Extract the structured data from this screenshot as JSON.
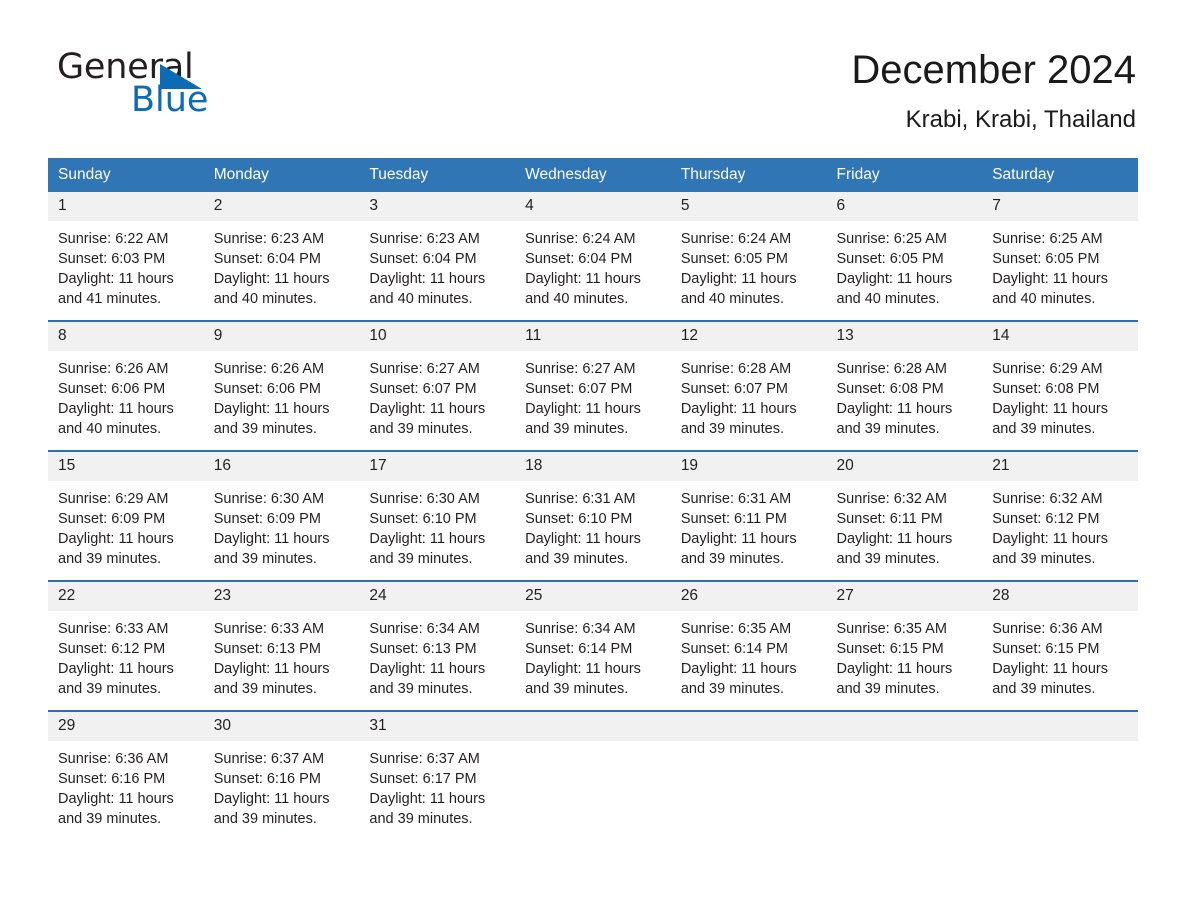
{
  "brand": {
    "name_part1": "General",
    "name_part2": "Blue",
    "accent_color": "#0b6cb5"
  },
  "header": {
    "month_title": "December 2024",
    "location": "Krabi, Krabi, Thailand"
  },
  "theme": {
    "header_blue": "#3075b4",
    "divider_blue": "#2f6fab",
    "daynum_band": "#f1f1f1"
  },
  "weekday_headers": [
    "Sunday",
    "Monday",
    "Tuesday",
    "Wednesday",
    "Thursday",
    "Friday",
    "Saturday"
  ],
  "weeks": [
    [
      {
        "day": "1",
        "sunrise": "Sunrise: 6:22 AM",
        "sunset": "Sunset: 6:03 PM",
        "daylight1": "Daylight: 11 hours",
        "daylight2": "and 41 minutes."
      },
      {
        "day": "2",
        "sunrise": "Sunrise: 6:23 AM",
        "sunset": "Sunset: 6:04 PM",
        "daylight1": "Daylight: 11 hours",
        "daylight2": "and 40 minutes."
      },
      {
        "day": "3",
        "sunrise": "Sunrise: 6:23 AM",
        "sunset": "Sunset: 6:04 PM",
        "daylight1": "Daylight: 11 hours",
        "daylight2": "and 40 minutes."
      },
      {
        "day": "4",
        "sunrise": "Sunrise: 6:24 AM",
        "sunset": "Sunset: 6:04 PM",
        "daylight1": "Daylight: 11 hours",
        "daylight2": "and 40 minutes."
      },
      {
        "day": "5",
        "sunrise": "Sunrise: 6:24 AM",
        "sunset": "Sunset: 6:05 PM",
        "daylight1": "Daylight: 11 hours",
        "daylight2": "and 40 minutes."
      },
      {
        "day": "6",
        "sunrise": "Sunrise: 6:25 AM",
        "sunset": "Sunset: 6:05 PM",
        "daylight1": "Daylight: 11 hours",
        "daylight2": "and 40 minutes."
      },
      {
        "day": "7",
        "sunrise": "Sunrise: 6:25 AM",
        "sunset": "Sunset: 6:05 PM",
        "daylight1": "Daylight: 11 hours",
        "daylight2": "and 40 minutes."
      }
    ],
    [
      {
        "day": "8",
        "sunrise": "Sunrise: 6:26 AM",
        "sunset": "Sunset: 6:06 PM",
        "daylight1": "Daylight: 11 hours",
        "daylight2": "and 40 minutes."
      },
      {
        "day": "9",
        "sunrise": "Sunrise: 6:26 AM",
        "sunset": "Sunset: 6:06 PM",
        "daylight1": "Daylight: 11 hours",
        "daylight2": "and 39 minutes."
      },
      {
        "day": "10",
        "sunrise": "Sunrise: 6:27 AM",
        "sunset": "Sunset: 6:07 PM",
        "daylight1": "Daylight: 11 hours",
        "daylight2": "and 39 minutes."
      },
      {
        "day": "11",
        "sunrise": "Sunrise: 6:27 AM",
        "sunset": "Sunset: 6:07 PM",
        "daylight1": "Daylight: 11 hours",
        "daylight2": "and 39 minutes."
      },
      {
        "day": "12",
        "sunrise": "Sunrise: 6:28 AM",
        "sunset": "Sunset: 6:07 PM",
        "daylight1": "Daylight: 11 hours",
        "daylight2": "and 39 minutes."
      },
      {
        "day": "13",
        "sunrise": "Sunrise: 6:28 AM",
        "sunset": "Sunset: 6:08 PM",
        "daylight1": "Daylight: 11 hours",
        "daylight2": "and 39 minutes."
      },
      {
        "day": "14",
        "sunrise": "Sunrise: 6:29 AM",
        "sunset": "Sunset: 6:08 PM",
        "daylight1": "Daylight: 11 hours",
        "daylight2": "and 39 minutes."
      }
    ],
    [
      {
        "day": "15",
        "sunrise": "Sunrise: 6:29 AM",
        "sunset": "Sunset: 6:09 PM",
        "daylight1": "Daylight: 11 hours",
        "daylight2": "and 39 minutes."
      },
      {
        "day": "16",
        "sunrise": "Sunrise: 6:30 AM",
        "sunset": "Sunset: 6:09 PM",
        "daylight1": "Daylight: 11 hours",
        "daylight2": "and 39 minutes."
      },
      {
        "day": "17",
        "sunrise": "Sunrise: 6:30 AM",
        "sunset": "Sunset: 6:10 PM",
        "daylight1": "Daylight: 11 hours",
        "daylight2": "and 39 minutes."
      },
      {
        "day": "18",
        "sunrise": "Sunrise: 6:31 AM",
        "sunset": "Sunset: 6:10 PM",
        "daylight1": "Daylight: 11 hours",
        "daylight2": "and 39 minutes."
      },
      {
        "day": "19",
        "sunrise": "Sunrise: 6:31 AM",
        "sunset": "Sunset: 6:11 PM",
        "daylight1": "Daylight: 11 hours",
        "daylight2": "and 39 minutes."
      },
      {
        "day": "20",
        "sunrise": "Sunrise: 6:32 AM",
        "sunset": "Sunset: 6:11 PM",
        "daylight1": "Daylight: 11 hours",
        "daylight2": "and 39 minutes."
      },
      {
        "day": "21",
        "sunrise": "Sunrise: 6:32 AM",
        "sunset": "Sunset: 6:12 PM",
        "daylight1": "Daylight: 11 hours",
        "daylight2": "and 39 minutes."
      }
    ],
    [
      {
        "day": "22",
        "sunrise": "Sunrise: 6:33 AM",
        "sunset": "Sunset: 6:12 PM",
        "daylight1": "Daylight: 11 hours",
        "daylight2": "and 39 minutes."
      },
      {
        "day": "23",
        "sunrise": "Sunrise: 6:33 AM",
        "sunset": "Sunset: 6:13 PM",
        "daylight1": "Daylight: 11 hours",
        "daylight2": "and 39 minutes."
      },
      {
        "day": "24",
        "sunrise": "Sunrise: 6:34 AM",
        "sunset": "Sunset: 6:13 PM",
        "daylight1": "Daylight: 11 hours",
        "daylight2": "and 39 minutes."
      },
      {
        "day": "25",
        "sunrise": "Sunrise: 6:34 AM",
        "sunset": "Sunset: 6:14 PM",
        "daylight1": "Daylight: 11 hours",
        "daylight2": "and 39 minutes."
      },
      {
        "day": "26",
        "sunrise": "Sunrise: 6:35 AM",
        "sunset": "Sunset: 6:14 PM",
        "daylight1": "Daylight: 11 hours",
        "daylight2": "and 39 minutes."
      },
      {
        "day": "27",
        "sunrise": "Sunrise: 6:35 AM",
        "sunset": "Sunset: 6:15 PM",
        "daylight1": "Daylight: 11 hours",
        "daylight2": "and 39 minutes."
      },
      {
        "day": "28",
        "sunrise": "Sunrise: 6:36 AM",
        "sunset": "Sunset: 6:15 PM",
        "daylight1": "Daylight: 11 hours",
        "daylight2": "and 39 minutes."
      }
    ],
    [
      {
        "day": "29",
        "sunrise": "Sunrise: 6:36 AM",
        "sunset": "Sunset: 6:16 PM",
        "daylight1": "Daylight: 11 hours",
        "daylight2": "and 39 minutes."
      },
      {
        "day": "30",
        "sunrise": "Sunrise: 6:37 AM",
        "sunset": "Sunset: 6:16 PM",
        "daylight1": "Daylight: 11 hours",
        "daylight2": "and 39 minutes."
      },
      {
        "day": "31",
        "sunrise": "Sunrise: 6:37 AM",
        "sunset": "Sunset: 6:17 PM",
        "daylight1": "Daylight: 11 hours",
        "daylight2": "and 39 minutes."
      },
      {
        "day": "",
        "sunrise": "",
        "sunset": "",
        "daylight1": "",
        "daylight2": ""
      },
      {
        "day": "",
        "sunrise": "",
        "sunset": "",
        "daylight1": "",
        "daylight2": ""
      },
      {
        "day": "",
        "sunrise": "",
        "sunset": "",
        "daylight1": "",
        "daylight2": ""
      },
      {
        "day": "",
        "sunrise": "",
        "sunset": "",
        "daylight1": "",
        "daylight2": ""
      }
    ]
  ]
}
